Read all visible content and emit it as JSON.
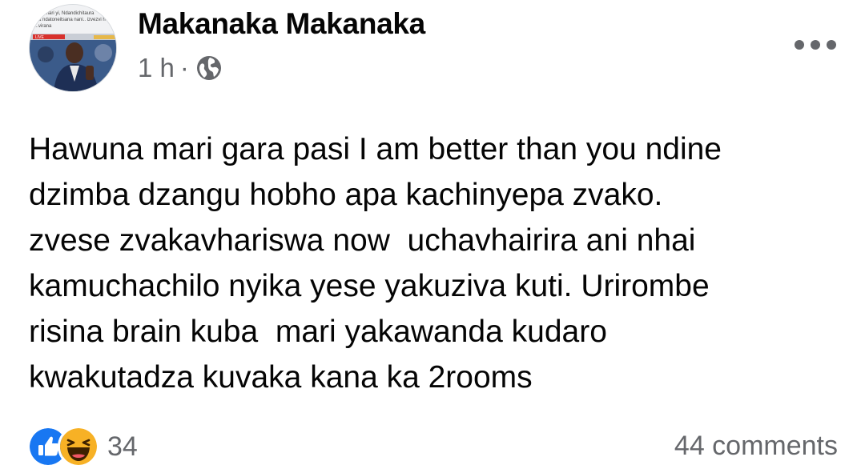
{
  "post": {
    "author_name": "Makanaka Makanaka",
    "time": "1 h",
    "separator": "·",
    "audience_icon": "globe-icon",
    "more_icon": "more-horizontal-icon",
    "text_lines": [
      "Hawuna mari gara pasi I am better than you ndine",
      "dzimba dzangu hobho apa kachinyepa zvako.",
      "zvese zvakavhariswa now  uchavhairira ani nhai",
      "kamuchachilo nyika yese yakuziva kuti. Urirombe",
      "risina brain kuba  mari yakawanda kudaro",
      "kwakutadza kuvaka kana ka 2rooms"
    ]
  },
  "avatar": {
    "caption_lines": [
      "...mari yi, Ndandichitaura",
      "...a ndatoneitsana nani.. izvezvi h",
      "...virana"
    ],
    "banner_text": "LIVE"
  },
  "footer": {
    "reaction_icons": [
      "like-icon",
      "haha-icon"
    ],
    "reaction_count": "34",
    "comments": "44 comments"
  },
  "colors": {
    "text": "#050505",
    "secondary_text": "#65676b",
    "like_blue": "#1877f2",
    "haha_yellow": "#f7b125"
  }
}
